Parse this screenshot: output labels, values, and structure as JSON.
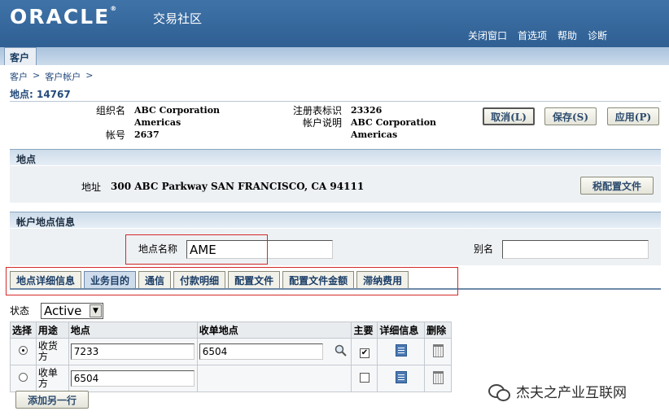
{
  "header": {
    "logo": "ORACLE",
    "app_name": "交易社区",
    "links": [
      "关闭窗口",
      "首选项",
      "帮助",
      "诊断"
    ],
    "tab": "客户"
  },
  "breadcrumb": [
    "客户",
    "客户帐户"
  ],
  "page_title": "地点: 14767",
  "account": {
    "org_label": "组织名",
    "org_value": [
      "ABC Corporation",
      "Americas"
    ],
    "number_label": "帐号",
    "number_value": "2637",
    "reg_label": "注册表标识",
    "reg_value": "23326",
    "desc_label": "帐户说明",
    "desc_value": [
      "ABC Corporation",
      "Americas"
    ]
  },
  "buttons": {
    "cancel": "取消(L)",
    "save": "保存(S)",
    "apply": "应用(P)",
    "tax_profile": "税配置文件",
    "add_row": "添加另一行"
  },
  "location_section": {
    "title": "地点",
    "address_label": "地址",
    "address_value": "300 ABC Parkway SAN FRANCISCO, CA 94111"
  },
  "account_location_section": {
    "title": "帐户地点信息",
    "name_label": "地点名称",
    "name_value": "AME",
    "alias_label": "别名",
    "alias_value": ""
  },
  "subtabs": [
    "地点详细信息",
    "业务目的",
    "通信",
    "付款明细",
    "配置文件",
    "配置文件金额",
    "滞纳费用"
  ],
  "status": {
    "label": "状态",
    "value": "Active"
  },
  "table": {
    "headers": [
      "选择",
      "用途",
      "地点",
      "收单地点",
      "主要",
      "详细信息",
      "删除"
    ],
    "rows": [
      {
        "purpose": [
          "收货",
          "方"
        ],
        "location": "7233",
        "bill_to": "6504",
        "selected": true,
        "primary": true
      },
      {
        "purpose": [
          "收单",
          "方"
        ],
        "location": "6504",
        "bill_to": "",
        "selected": false,
        "primary": false
      }
    ]
  },
  "watermark": "杰夫之产业互联网",
  "colors": {
    "header": "#3f73a8",
    "accent_text": "#234a7b",
    "highlight_box": "#d42a2a"
  }
}
